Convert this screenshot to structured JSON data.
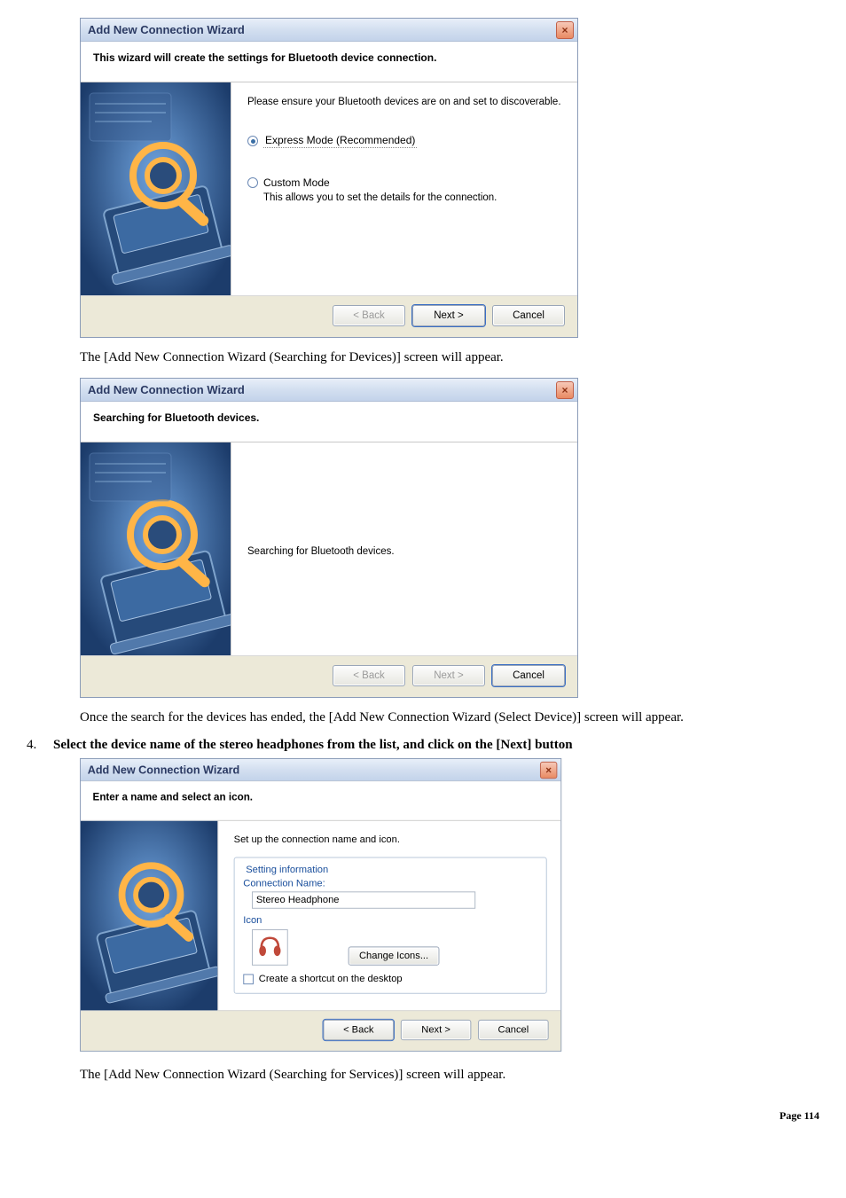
{
  "dlg1": {
    "title": "Add New Connection Wizard",
    "header": "This wizard will create the settings for Bluetooth device connection.",
    "instruction": "Please ensure your Bluetooth devices are on and set to discoverable.",
    "radio_express": "Express Mode (Recommended)",
    "radio_custom": "Custom Mode",
    "custom_note": "This allows you to set the details for the connection.",
    "btn_back": "< Back",
    "btn_next": "Next >",
    "btn_cancel": "Cancel"
  },
  "narr1": "The [Add New Connection Wizard (Searching for Devices)] screen will appear.",
  "dlg2": {
    "title": "Add New Connection Wizard",
    "header": "Searching for Bluetooth devices.",
    "message": "Searching for Bluetooth devices.",
    "btn_back": "< Back",
    "btn_next": "Next >",
    "btn_cancel": "Cancel"
  },
  "narr2": "Once the search for the devices has ended, the [Add New Connection Wizard (Select Device)] screen will appear.",
  "step4_num": "4.",
  "step4_text": "Select the device name of the stereo headphones from the list, and click on the [Next] button",
  "dlg3": {
    "title": "Add New Connection Wizard",
    "header": "Enter a name and select an icon.",
    "instruction": "Set up the connection name and icon.",
    "legend": "Setting information",
    "conn_name_label": "Connection Name:",
    "conn_name_value": "Stereo Headphone",
    "icon_label": "Icon",
    "change_icons": "Change Icons...",
    "chk_label": "Create a shortcut on the desktop",
    "btn_back": "< Back",
    "btn_next": "Next >",
    "btn_cancel": "Cancel"
  },
  "narr3": "The [Add New Connection Wizard (Searching for Services)] screen will appear.",
  "page_footer": "Page 114"
}
